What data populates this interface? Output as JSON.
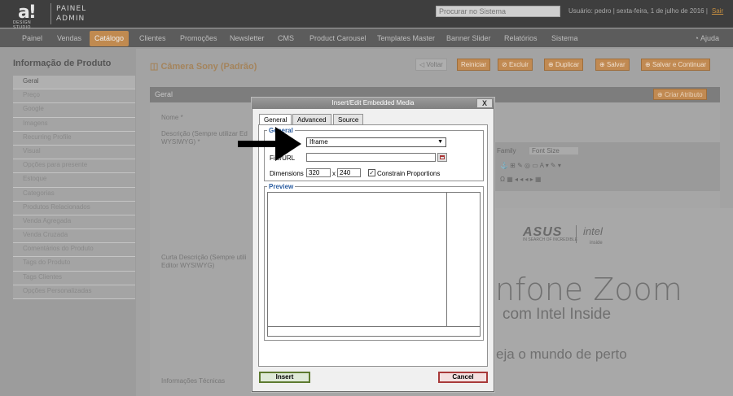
{
  "header": {
    "logo_mark": "a!",
    "logo_sub": "DESIGN STUDIO",
    "panel_line1": "PAINEL",
    "panel_line2": "ADMIN",
    "search_placeholder": "Procurar no Sistema",
    "user_info": "Usuário: pedro | sexta-feira, 1 de julho de 2016 |",
    "logout": "Sair"
  },
  "nav": {
    "items": [
      "Painel",
      "Vendas",
      "Catálogo",
      "Clientes",
      "Promoções",
      "Newsletter",
      "CMS",
      "Product Carousel",
      "Templates Master",
      "Banner Slider",
      "Relatórios",
      "Sistema"
    ],
    "active": "Catálogo",
    "help": "Ajuda"
  },
  "sidebar": {
    "title": "Informação de Produto",
    "items": [
      "Geral",
      "Preço",
      "Google",
      "Imagens",
      "Recurring Profile",
      "Visual",
      "Opções para presente",
      "Estoque",
      "Categorias",
      "Produtos Relacionados",
      "Venda Agregada",
      "Venda Cruzada",
      "Comentários do Produto",
      "Tags do Produto",
      "Tags Clientes",
      "Opções Personalizadas"
    ]
  },
  "product": {
    "title": "Câmera Sony (Padrão)",
    "buttons": [
      "Voltar",
      "Reiniciar",
      "Excluir",
      "Duplicar",
      "Salvar",
      "Salvar e Continuar"
    ],
    "section": "Geral",
    "create_attr": "Criar Atributo",
    "label_name": "Nome *",
    "label_desc1": "Descrição (Sempre utilizar Ed",
    "label_desc2": "WYSIWYG) *",
    "label_short1": "Curta Descrição (Sempre utili",
    "label_short2": "Editor WYSIWYG)",
    "label_tech": "Informações Técnicas"
  },
  "editor": {
    "family": "Family",
    "font_size": "Font Size",
    "banner_brand": "ASUS",
    "banner_brand_sub": "IN SEARCH OF INCREDIBLE",
    "banner_intel": "intel",
    "banner_intel_sub": "inside",
    "banner_line1": "nfone Zoom",
    "banner_line2": "com Intel Inside",
    "banner_line3": "eja o mundo de perto"
  },
  "dialog": {
    "title": "Insert/Edit Embedded Media",
    "close": "X",
    "tabs": [
      "General",
      "Advanced",
      "Source"
    ],
    "general_legend": "General",
    "type_value": "Iframe",
    "file_label": "File/URL",
    "dimensions_label": "Dimensions",
    "width": "320",
    "x_sep": "x",
    "height": "240",
    "constrain_label": "Constrain Proportions",
    "constrain_checked": true,
    "preview_legend": "Preview",
    "insert": "Insert",
    "cancel": "Cancel"
  }
}
